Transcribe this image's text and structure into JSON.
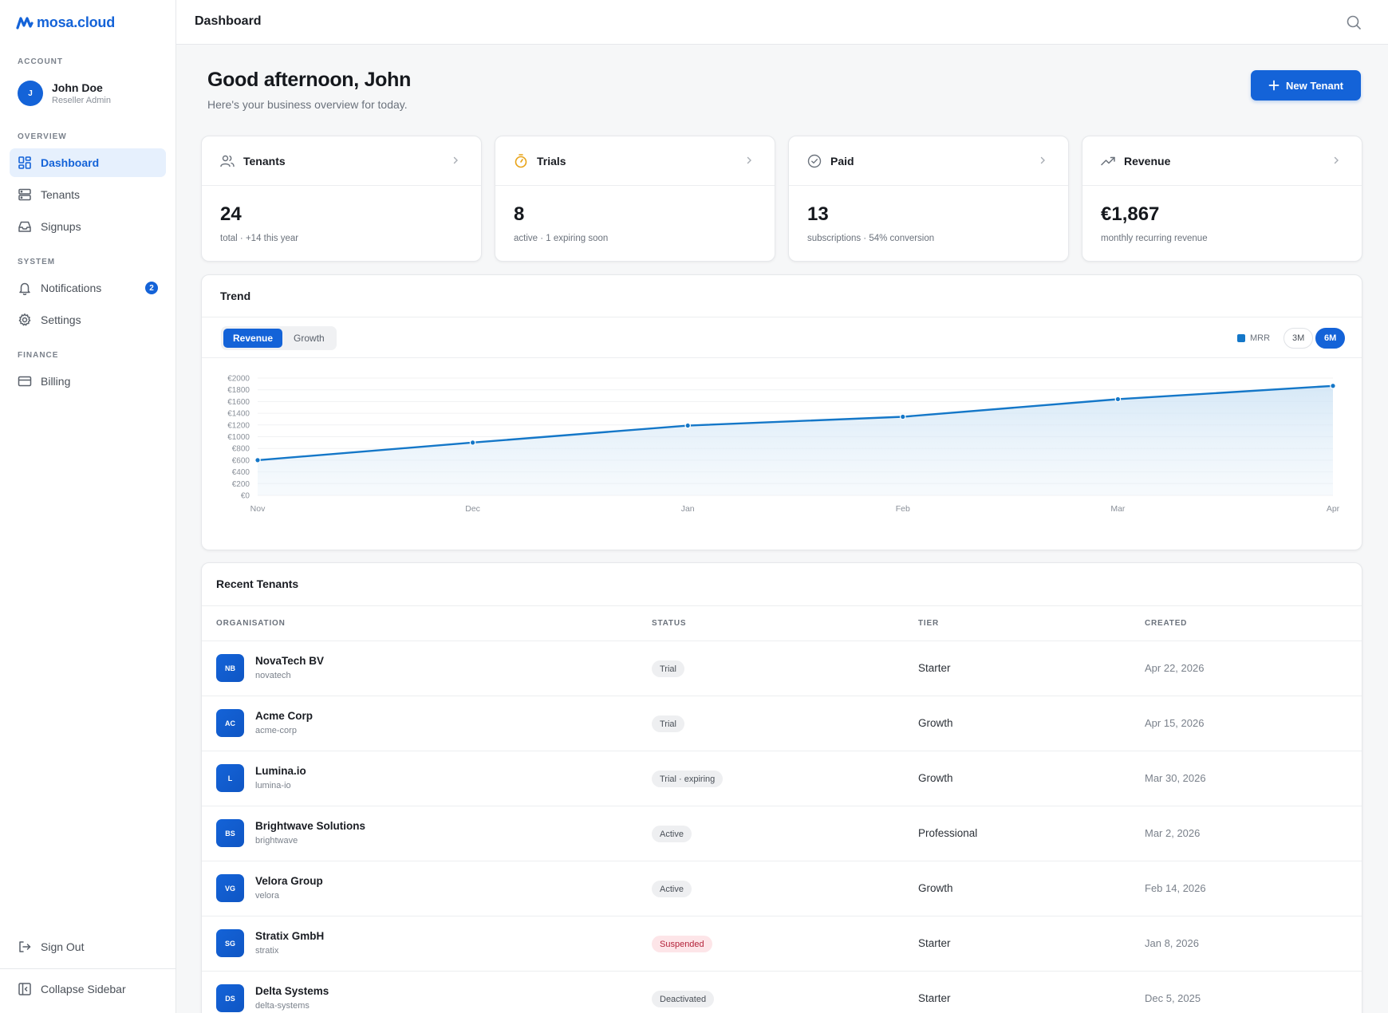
{
  "brand": {
    "logo_text": "mosa.cloud",
    "accent": "#1463d8"
  },
  "sidebar": {
    "account_label": "ACCOUNT",
    "user": {
      "initial": "J",
      "name": "John Doe",
      "role": "Reseller Admin"
    },
    "overview_label": "OVERVIEW",
    "system_label": "SYSTEM",
    "finance_label": "FINANCE",
    "items": {
      "dashboard": "Dashboard",
      "tenants": "Tenants",
      "signups": "Signups",
      "notifications": "Notifications",
      "notifications_count": "2",
      "settings": "Settings",
      "billing": "Billing"
    },
    "sign_out": "Sign Out",
    "collapse": "Collapse Sidebar"
  },
  "header": {
    "title": "Dashboard",
    "search_icon": "search-icon"
  },
  "main": {
    "greeting": "Good afternoon, John",
    "subtitle": "Here's your business overview for today.",
    "new_tenant_label": "New Tenant"
  },
  "stats": [
    {
      "title": "Tenants",
      "value": "24",
      "sub": "total · +14 this year",
      "icon": "users-icon"
    },
    {
      "title": "Trials",
      "value": "8",
      "sub": "active · 1 expiring soon",
      "icon": "stopwatch-icon"
    },
    {
      "title": "Paid",
      "value": "13",
      "sub": "subscriptions · 54% conversion",
      "icon": "check-circle-icon"
    },
    {
      "title": "Revenue",
      "value": "€1,867",
      "sub": "monthly recurring revenue",
      "icon": "trending-up-icon"
    }
  ],
  "trend": {
    "title": "Trend",
    "tabs": [
      "Revenue",
      "Growth"
    ],
    "active_tab": "Revenue",
    "legend": "MRR",
    "ranges": [
      "3M",
      "6M"
    ],
    "active_range": "6M"
  },
  "chart_data": {
    "type": "area",
    "categories": [
      "Nov",
      "Dec",
      "Jan",
      "Feb",
      "Mar",
      "Apr"
    ],
    "series": [
      {
        "name": "MRR",
        "values": [
          600,
          900,
          1190,
          1340,
          1640,
          1867
        ]
      }
    ],
    "ylim": [
      0,
      2000
    ],
    "yticks": [
      0,
      200,
      400,
      600,
      800,
      1000,
      1200,
      1400,
      1600,
      1800,
      2000
    ],
    "ytick_prefix": "€",
    "grid": true,
    "legend_position": "top-right",
    "line_color": "#1477c8"
  },
  "recent": {
    "title": "Recent Tenants",
    "columns": [
      "ORGANISATION",
      "STATUS",
      "TIER",
      "CREATED"
    ],
    "rows": [
      {
        "initials": "NB",
        "name": "NovaTech BV",
        "slug": "novatech",
        "status": "Trial",
        "tier": "Starter",
        "created": "Apr 22, 2026"
      },
      {
        "initials": "AC",
        "name": "Acme Corp",
        "slug": "acme-corp",
        "status": "Trial",
        "tier": "Growth",
        "created": "Apr 15, 2026"
      },
      {
        "initials": "L",
        "name": "Lumina.io",
        "slug": "lumina-io",
        "status": "Trial · expiring",
        "tier": "Growth",
        "created": "Mar 30, 2026"
      },
      {
        "initials": "BS",
        "name": "Brightwave Solutions",
        "slug": "brightwave",
        "status": "Active",
        "tier": "Professional",
        "created": "Mar 2, 2026"
      },
      {
        "initials": "VG",
        "name": "Velora Group",
        "slug": "velora",
        "status": "Active",
        "tier": "Growth",
        "created": "Feb 14, 2026"
      },
      {
        "initials": "SG",
        "name": "Stratix GmbH",
        "slug": "stratix",
        "status": "Suspended",
        "tier": "Starter",
        "created": "Jan 8, 2026"
      },
      {
        "initials": "DS",
        "name": "Delta Systems",
        "slug": "delta-systems",
        "status": "Deactivated",
        "tier": "Starter",
        "created": "Dec 5, 2025"
      }
    ]
  }
}
